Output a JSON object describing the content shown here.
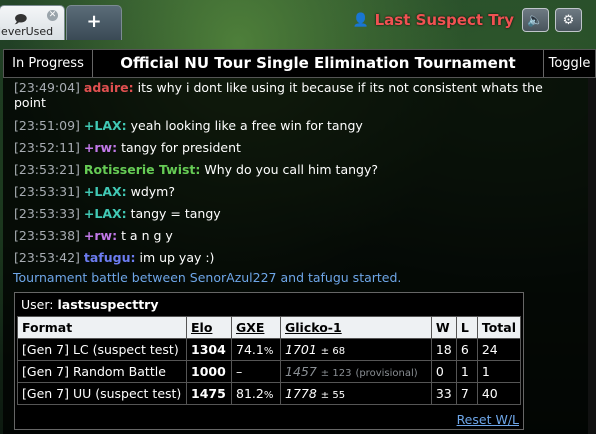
{
  "colors": {
    "username": "#f05252",
    "nick_adaire": "#e05050",
    "nick_lax": "#41c9b5",
    "nick_rw": "#c179e8",
    "nick_rotisserie": "#66cc55",
    "nick_tafugu": "#6c7cf0",
    "notice": "#6ea6e8"
  },
  "tabs": {
    "room_label": "leverUsed",
    "room_icon": "chat-icon",
    "close_icon": "close-icon",
    "new_tab_label": "+"
  },
  "user": {
    "name": "Last Suspect Try",
    "icon": "user-icon",
    "sound_icon": "speaker-icon",
    "settings_icon": "gear-icon"
  },
  "header": {
    "progress_label": "In Progress",
    "title": "Official NU Tour Single Elimination Tournament",
    "toggle_label": "Toggle"
  },
  "messages": [
    {
      "time": "[23:49:04]",
      "name": "adaire:",
      "text": "its why i dont like using it because if its not consistent whats the point"
    },
    {
      "time": "[23:51:09]",
      "name": "+LAX:",
      "text": "yeah looking like a free win for tangy"
    },
    {
      "time": "[23:52:11]",
      "name": "+rw:",
      "text": "tangy for president"
    },
    {
      "time": "[23:53:21]",
      "name": "Rotisserie Twist:",
      "text": "Why do you call him tangy?"
    },
    {
      "time": "[23:53:31]",
      "name": "+LAX:",
      "text": "wdym?"
    },
    {
      "time": "[23:53:33]",
      "name": "+LAX:",
      "text": "tangy = tangy"
    },
    {
      "time": "[23:53:38]",
      "name": "+rw:",
      "text": "t a n g y"
    },
    {
      "time": "[23:53:42]",
      "name": "tafugu:",
      "text": "im up yay :)"
    }
  ],
  "notice": "Tournament battle between SenorAzul227 and tafugu started.",
  "ladder": {
    "user_label": "User:",
    "user_name": "lastsuspecttry",
    "columns": [
      "Format",
      "Elo",
      "GXE",
      "Glicko-1",
      "W",
      "L",
      "Total"
    ],
    "rows": [
      {
        "format": "[Gen 7] LC (suspect test)",
        "elo": "1304",
        "gxe_main": "74.1",
        "gxe_unit": "%",
        "glicko_main": "1701",
        "glicko_dev": "± 68",
        "glicko_note": "",
        "w": "18",
        "l": "6",
        "total": "24"
      },
      {
        "format": "[Gen 7] Random Battle",
        "elo": "1000",
        "gxe_main": "–",
        "gxe_unit": "",
        "glicko_main": "1457",
        "glicko_dev": "± 123",
        "glicko_note": "(provisional)",
        "w": "0",
        "l": "1",
        "total": "1"
      },
      {
        "format": "[Gen 7] UU (suspect test)",
        "elo": "1475",
        "gxe_main": "81.2",
        "gxe_unit": "%",
        "glicko_main": "1778",
        "glicko_dev": "± 55",
        "glicko_note": "",
        "w": "33",
        "l": "7",
        "total": "40"
      }
    ],
    "reset_label": "Reset W/L"
  }
}
